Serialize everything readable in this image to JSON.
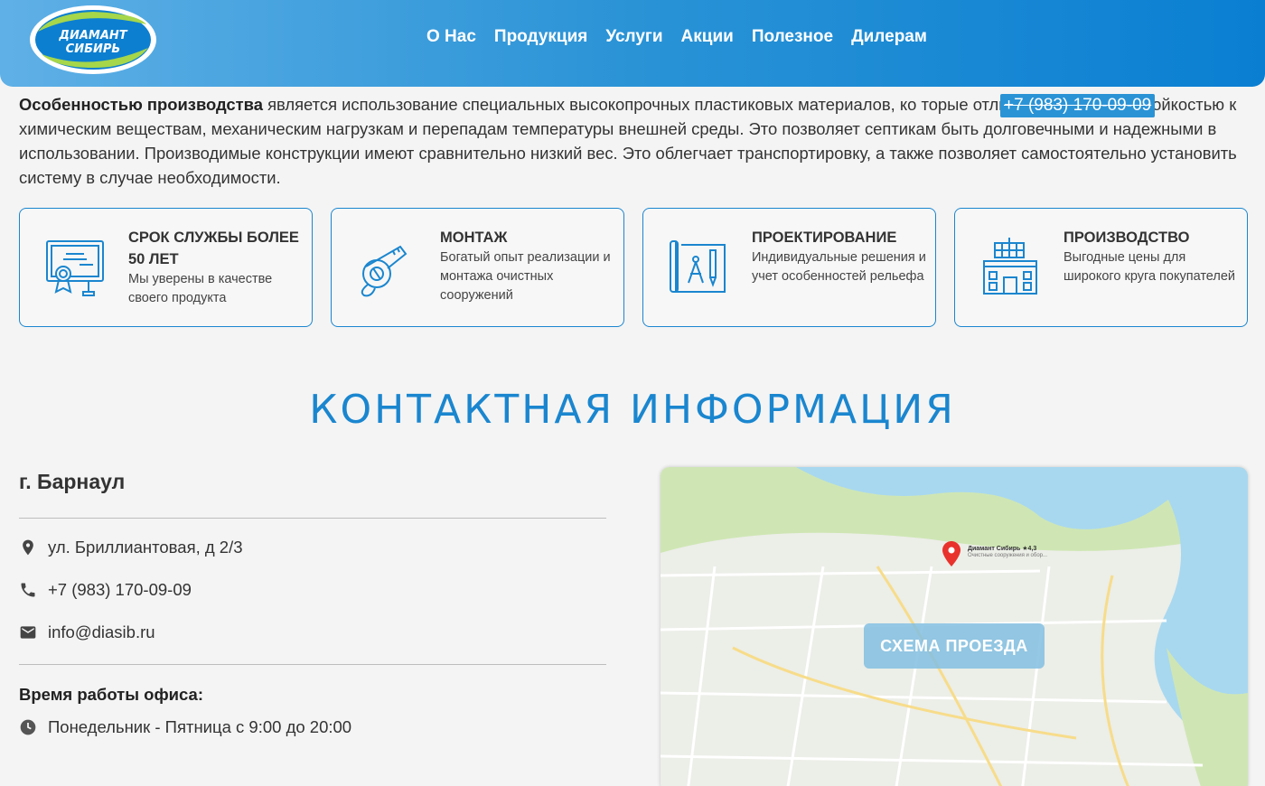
{
  "header": {
    "logo_line1": "ДИАМАНТ",
    "logo_line2": "СИБИРЬ",
    "nav": [
      "О Нас",
      "Продукция",
      "Услуги",
      "Акции",
      "Полезное",
      "Дилерам"
    ],
    "phone": "+7 (983) 170-09-09"
  },
  "intro": {
    "bold": "Особенностью производства",
    "text": " является использование специальных высокопрочных пластиковых материалов, ко     торые отличаются высокой стойкостью к химическим веществам, механическим нагрузкам и перепадам температуры внешней среды. Это позволяет септикам быть долговечными и надежными в использовании. Производимые конструкции имеют сравнительно низкий вес. Это облегчает транспортировку, а также позволяет самостоятельно установить систему в случае необходимости."
  },
  "features": [
    {
      "title": "СРОК СЛУЖБЫ БОЛЕЕ 50 ЛЕТ",
      "desc": "Мы уверены в качестве своего продукта",
      "icon": "certificate-icon"
    },
    {
      "title": "МОНТАЖ",
      "desc": "Богатый опыт реализации и монтажа очистных сооружений",
      "icon": "tape-measure-icon"
    },
    {
      "title": "ПРОЕКТИРОВАНИЕ",
      "desc": "Индивидуальные решения и учет особенностей рельефа",
      "icon": "blueprint-icon"
    },
    {
      "title": "ПРОИЗВОДСТВО",
      "desc": "Выгодные цены для широкого круга покупателей",
      "icon": "factory-icon"
    }
  ],
  "contacts": {
    "section_title": "КОНТАКТНАЯ ИНФОРМАЦИЯ",
    "city": "г. Барнаул",
    "address": "ул. Бриллиантовая, д 2/3",
    "phone": "+7 (983) 170-09-09",
    "email": "info@diasib.ru",
    "hours_title": "Время работы офиса:",
    "hours": "Понедельник - Пятница с 9:00 до 20:00"
  },
  "map": {
    "button": "СХЕМА ПРОЕЗДА",
    "place_name": "Диамант Сибирь ★4,3",
    "place_sub": "Очистные сооружения и обор..."
  },
  "colors": {
    "accent": "#1a86cf",
    "header_start": "#5fb0e6",
    "header_end": "#0a7fd2"
  }
}
